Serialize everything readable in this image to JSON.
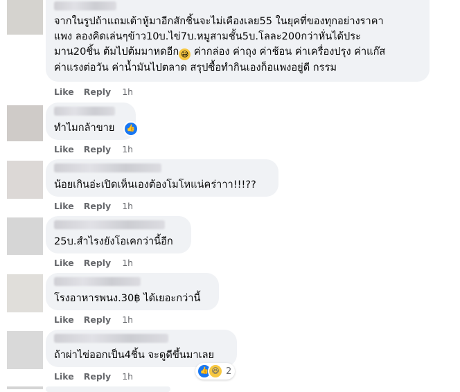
{
  "actions": {
    "like": "Like",
    "reply": "Reply"
  },
  "comments": [
    {
      "text": "จากในรูปถ้าแถมเต้าหู้มาอีกสักชิ้นจะไม่เคืองเลย55 ในยุคที่ของทุกอย่างราคา\nแพง ลองคิดเล่นๆข้าว10บ.ไข่7บ.หมูสามชั้น5บ.โลละ200กว่าหั่นได้ประ\nมาน20ชิ้น ต้มไปต้มมาหดอีก",
      "text2": " ค่ากล่อง ค่าถุง ค่าช้อน ค่าเครื่องปรุง ค่าแก๊ส\nค่าแรงต่อวัน ค่าน้ำมันไปตลาด สรุปซื้อทำกินเองก็อแพงอยู่ดี กรรม",
      "emoji": "😅",
      "time": "1h"
    },
    {
      "text": "ทำไมกล้าขาย",
      "time": "1h"
    },
    {
      "text": "น้อยเกินอ่ะเปิดเห็นเองต้องโมโหแน่คร่าาา!!!??",
      "time": "1h"
    },
    {
      "text": "25บ.สำไรงยังโอเคกว่านี้อีก",
      "time": "1h"
    },
    {
      "text": "โรงอาหารพนง.30฿ ได้เยอะกว่านี้",
      "time": "1h"
    },
    {
      "text": "ถ้าผ่าไข่ออกเป็น4ชิ้น จะดูดีขึ้นมาเลย",
      "time": "1h",
      "reaction_count": "2"
    }
  ],
  "icons": {
    "like_reaction": "like-icon",
    "haha_reaction": "haha-icon",
    "sweat_smile": "emoji-sweat-smile"
  },
  "colors": {
    "bubble": "#f0f2f5",
    "meta_text": "#65676b",
    "like_blue": "#1877f2"
  }
}
